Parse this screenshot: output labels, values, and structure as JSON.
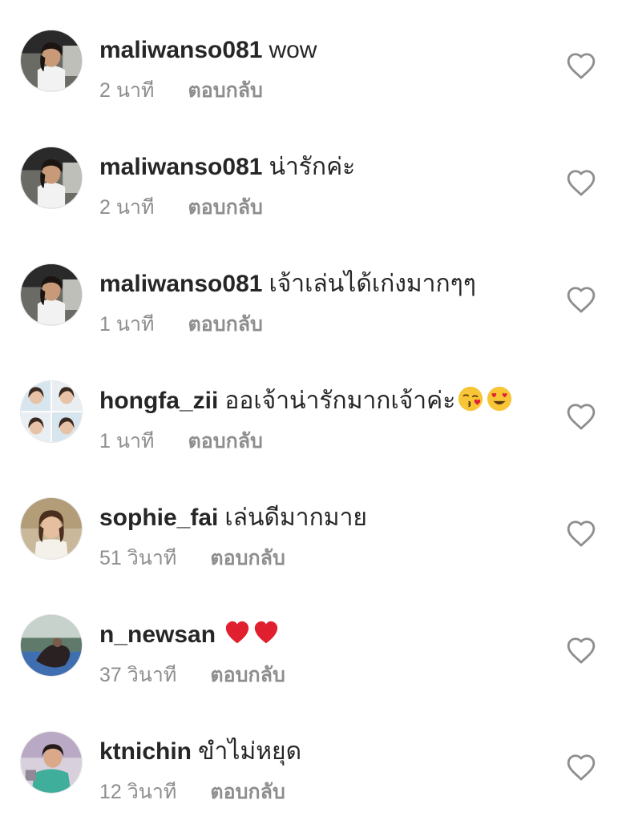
{
  "comments": [
    {
      "username": "maliwanso081",
      "text": "wow",
      "time": "2 นาที",
      "reply": "ตอบกลับ",
      "avatar": "woman-in-car-avatar",
      "emoji": []
    },
    {
      "username": "maliwanso081",
      "text": "น่ารักค่ะ",
      "time": "2 นาที",
      "reply": "ตอบกลับ",
      "avatar": "woman-in-car-avatar",
      "emoji": []
    },
    {
      "username": "maliwanso081",
      "text": "เจ้าเล่นได้เก่งมากๆๆ",
      "time": "1 นาที",
      "reply": "ตอบกลับ",
      "avatar": "woman-in-car-avatar",
      "emoji": []
    },
    {
      "username": "hongfa_zii",
      "text": "ออเจ้าน่ารักมากเจ้าค่ะ",
      "time": "1 นาที",
      "reply": "ตอบกลับ",
      "avatar": "photo-grid-avatar",
      "emoji": [
        "kissing-heart-emoji",
        "heart-eyes-emoji"
      ]
    },
    {
      "username": "sophie_fai",
      "text": "เล่นดีมากมาย",
      "time": "51 วินาที",
      "reply": "ตอบกลับ",
      "avatar": "woman-portrait-avatar",
      "emoji": []
    },
    {
      "username": "n_newsan",
      "text": "",
      "time": "37 วินาที",
      "reply": "ตอบกลับ",
      "avatar": "outdoor-photo-avatar",
      "emoji": [
        "red-heart-emoji",
        "red-heart-emoji"
      ]
    },
    {
      "username": "ktnichin",
      "text": "ขำไม่หยุด",
      "time": "12 วินาที",
      "reply": "ตอบกลับ",
      "avatar": "woman-green-shirt-avatar",
      "emoji": []
    }
  ],
  "colors": {
    "text": "#262626",
    "secondary_text": "#8e8e8e",
    "heart_outline": "#8e8e8e",
    "emoji_red_heart": "#e0202e",
    "emoji_yellow": "#f8c537"
  },
  "icons": {
    "like": "heart-outline-icon"
  }
}
